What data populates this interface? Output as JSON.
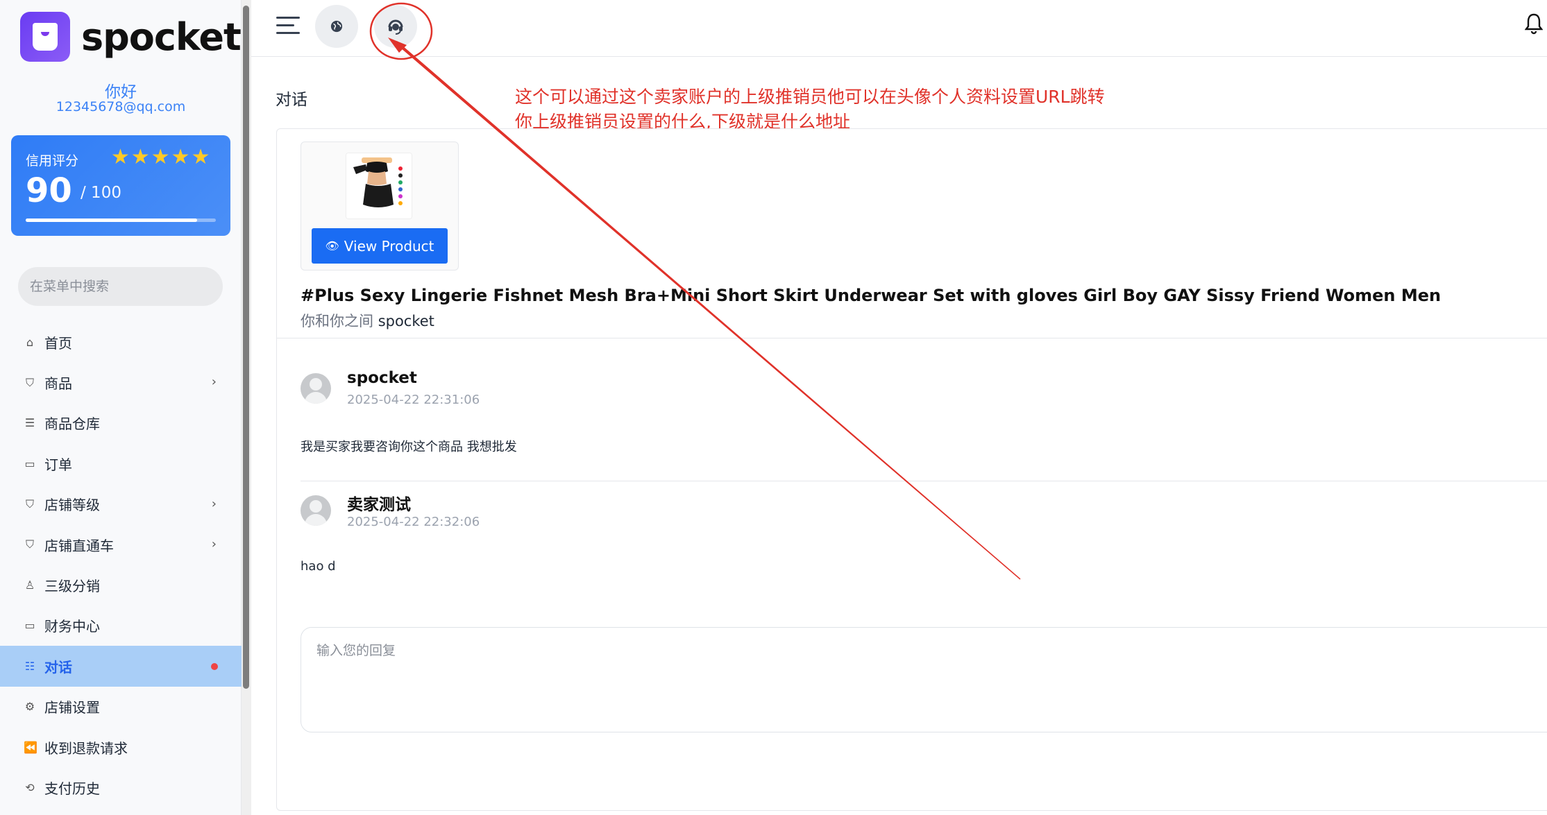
{
  "app": {
    "logo_text": "spocket"
  },
  "user": {
    "greeting": "你好",
    "email": "12345678@qq.com"
  },
  "credit": {
    "label": "信用评分",
    "stars": "★★★★★",
    "rating": 4.5,
    "score": "90",
    "max": "/ 100",
    "progress": 0.9
  },
  "sidebar": {
    "search_placeholder": "在菜单中搜索",
    "items": [
      {
        "label": "首页",
        "icon": "home-icon",
        "glyph": "⌂"
      },
      {
        "label": "商品",
        "icon": "bag-icon",
        "glyph": "⛉",
        "chevron": true
      },
      {
        "label": "商品仓库",
        "icon": "warehouse-icon",
        "glyph": "☰"
      },
      {
        "label": "订单",
        "icon": "ticket-icon",
        "glyph": "▭"
      },
      {
        "label": "店铺等级",
        "icon": "bag-icon",
        "glyph": "⛉",
        "chevron": true
      },
      {
        "label": "店铺直通车",
        "icon": "bag-icon",
        "glyph": "⛉",
        "chevron": true
      },
      {
        "label": "三级分销",
        "icon": "user-icon",
        "glyph": "♙"
      },
      {
        "label": "财务中心",
        "icon": "wallet-icon",
        "glyph": "▭"
      },
      {
        "label": "对话",
        "icon": "chat-icon",
        "glyph": "☷",
        "active": true
      },
      {
        "label": "店铺设置",
        "icon": "gear-icon",
        "glyph": "⚙"
      },
      {
        "label": "收到退款请求",
        "icon": "rewind-icon",
        "glyph": "⏪"
      },
      {
        "label": "支付历史",
        "icon": "history-icon",
        "glyph": "⟲"
      }
    ]
  },
  "topbar": {
    "globe_icon": "globe-icon",
    "support_icon": "headset-icon",
    "bell_icon": "bell-icon"
  },
  "page": {
    "title": "对话"
  },
  "annotation": {
    "line1": "这个可以通过这个卖家账户的上级推销员他可以在头像个人资料设置URL跳转",
    "line2": "你上级推销员设置的什么,下级就是什么地址",
    "color": "#e0322a"
  },
  "product": {
    "view_button": "View Product",
    "title": "#Plus Sexy Lingerie Fishnet Mesh Bra+Mini Short Skirt Underwear Set with gloves Girl Boy GAY Sissy Friend Women Men",
    "between_prefix": "你和你之间",
    "between_name": "spocket"
  },
  "messages": [
    {
      "name": "spocket",
      "time": "2025-04-22 22:31:06",
      "text": "我是买家我要咨询你这个商品 我想批发"
    },
    {
      "name": "卖家测试",
      "time": "2025-04-22 22:32:06",
      "text": "hao d"
    }
  ],
  "reply": {
    "placeholder": "输入您的回复"
  },
  "colors": {
    "accent": "#1a6cf3",
    "active_bg": "#a9cef7",
    "credit_bg": "#2f7cf6"
  }
}
